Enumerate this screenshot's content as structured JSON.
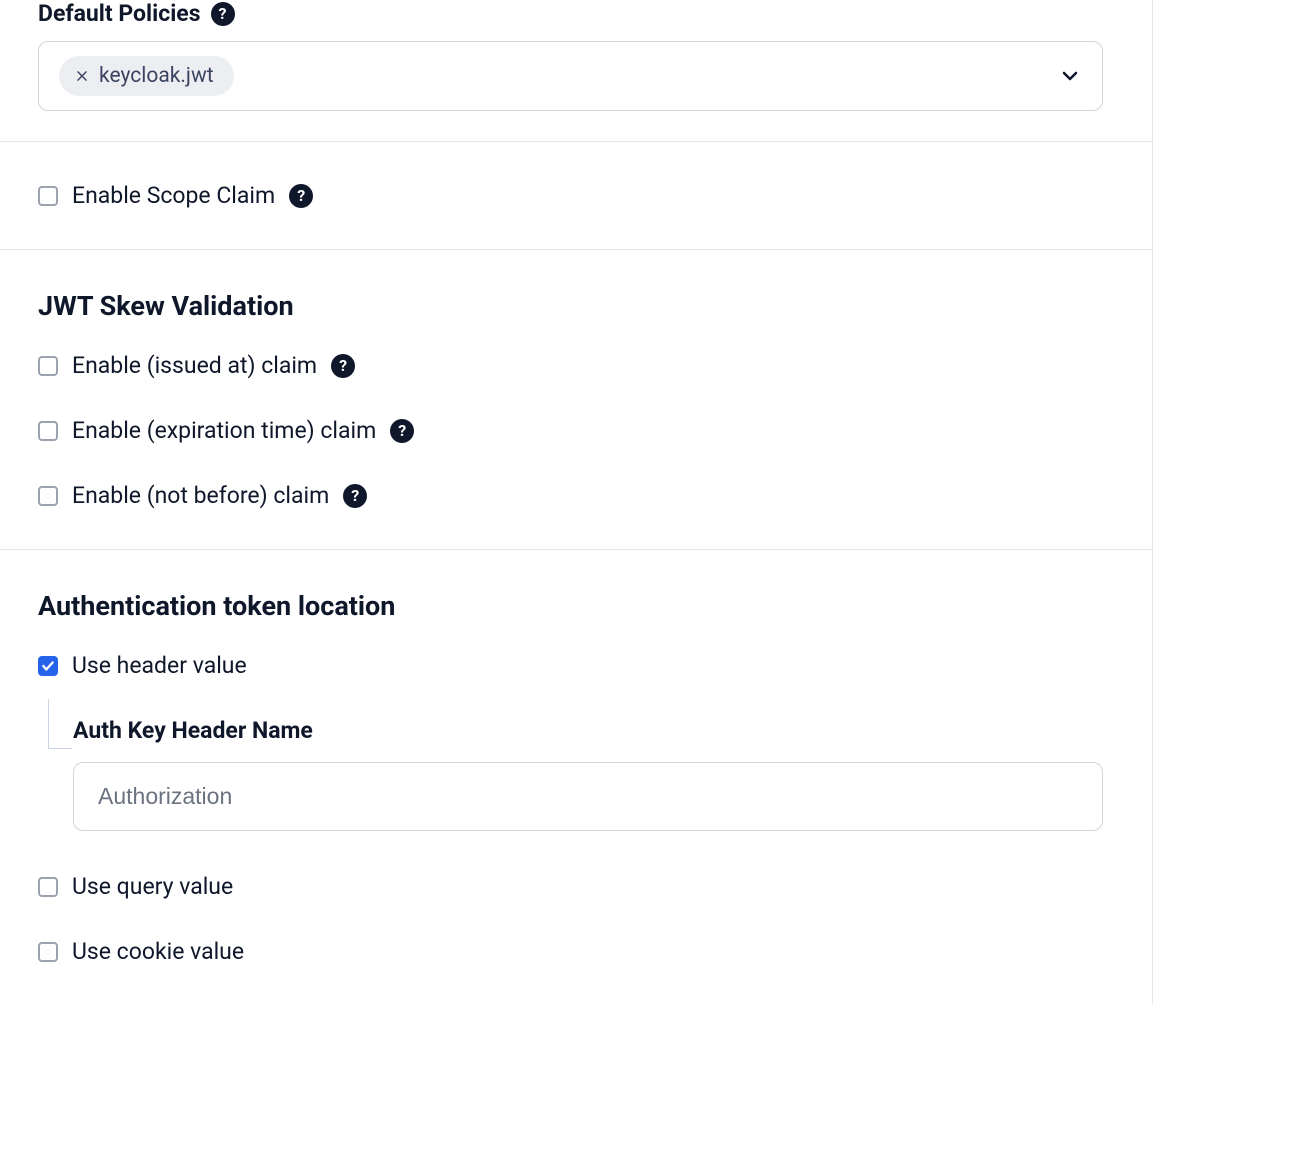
{
  "defaultPolicies": {
    "label": "Default Policies",
    "tags": [
      {
        "label": "keycloak.jwt"
      }
    ]
  },
  "enableScopeClaim": {
    "label": "Enable Scope Claim",
    "checked": false
  },
  "jwtSkew": {
    "title": "JWT Skew Validation",
    "issuedAt": {
      "label": "Enable (issued at) claim",
      "checked": false
    },
    "expiration": {
      "label": "Enable (expiration time) claim",
      "checked": false
    },
    "notBefore": {
      "label": "Enable (not before) claim",
      "checked": false
    }
  },
  "authTokenLocation": {
    "title": "Authentication token location",
    "useHeader": {
      "label": "Use header value",
      "checked": true,
      "headerName": {
        "label": "Auth Key Header Name",
        "placeholder": "Authorization",
        "value": ""
      }
    },
    "useQuery": {
      "label": "Use query value",
      "checked": false
    },
    "useCookie": {
      "label": "Use cookie value",
      "checked": false
    }
  }
}
